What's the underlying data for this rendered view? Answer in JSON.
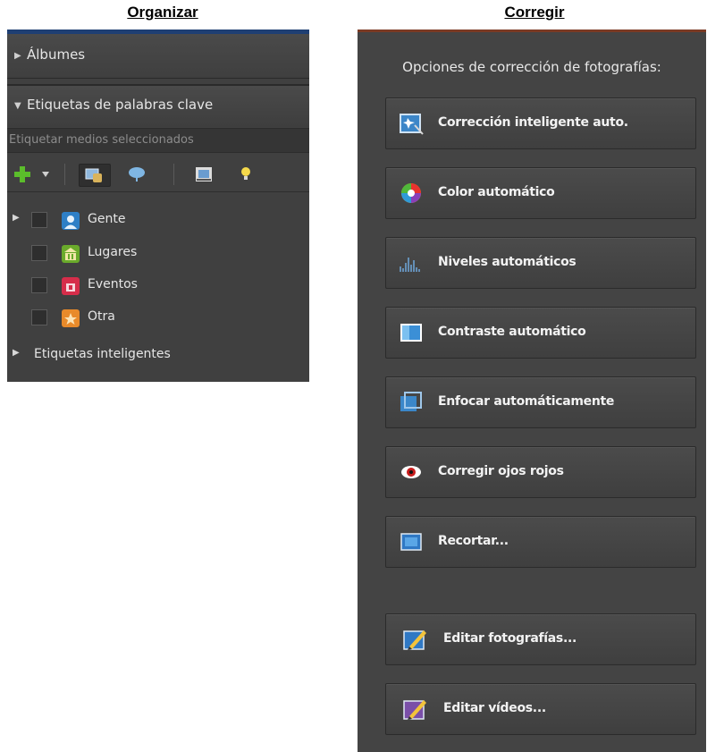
{
  "headings": {
    "left": "Organizar",
    "right": "Corregir"
  },
  "organize": {
    "albums_label": "Álbumes",
    "keyword_tags_label": "Etiquetas de palabras clave",
    "tag_input_placeholder": "Etiquetar medios seleccionados",
    "toolbar_icons": [
      "plus-icon",
      "dropdown-arrow-icon",
      "people-tag-icon",
      "cloud-tag-icon",
      "image-icon",
      "lightbulb-icon"
    ],
    "tags": [
      {
        "label": "Gente",
        "color": "#2e7fc6",
        "icon": "person-icon",
        "has_children": true
      },
      {
        "label": "Lugares",
        "color": "#6aaa2b",
        "icon": "building-icon",
        "has_children": false
      },
      {
        "label": "Eventos",
        "color": "#d62d4a",
        "icon": "event-icon",
        "has_children": false
      },
      {
        "label": "Otra",
        "color": "#e88a2a",
        "icon": "star-icon",
        "has_children": false
      }
    ],
    "smart_tags_label": "Etiquetas inteligentes"
  },
  "fix": {
    "title": "Opciones de corrección de fotografías:",
    "buttons": [
      {
        "label": "Corrección inteligente auto.",
        "icon": "smart-fix-icon"
      },
      {
        "label": "Color automático",
        "icon": "color-wheel-icon"
      },
      {
        "label": "Niveles automáticos",
        "icon": "levels-icon"
      },
      {
        "label": "Contraste automático",
        "icon": "contrast-icon"
      },
      {
        "label": "Enfocar automáticamente",
        "icon": "sharpen-icon"
      },
      {
        "label": "Corregir ojos rojos",
        "icon": "red-eye-icon"
      },
      {
        "label": "Recortar...",
        "icon": "crop-icon"
      },
      {
        "label": "Editar fotografías...",
        "icon": "edit-photo-icon"
      },
      {
        "label": "Editar vídeos...",
        "icon": "edit-video-icon"
      }
    ]
  }
}
